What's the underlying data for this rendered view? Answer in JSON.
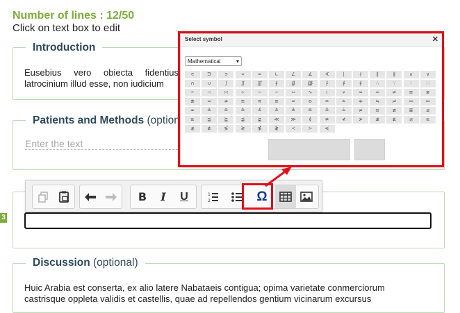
{
  "header": {
    "lines_count": "Number of lines : 12/50",
    "click_hint": "Click on text box to edit"
  },
  "sections": {
    "introduction": {
      "title": "Introduction",
      "text": "Eusebius vero obiecta fidentius latrocinium illud esse, non iudicium"
    },
    "patients_methods": {
      "title": "Patients and Methods",
      "optional": "(optional)",
      "placeholder": "Enter the text"
    },
    "results": {
      "badge": "3"
    },
    "discussion": {
      "title": "Discussion",
      "optional": "(optional)",
      "line1": "Huic Arabia est conserta, ex alio latere Nabataeis contigua; opima varietate conmerciorum",
      "line2": "castrisque oppleta validis et castellis, quae ad repellendos gentium vicinarum excursus"
    }
  },
  "toolbar": {
    "buttons": [
      "copy-icon",
      "paste-icon",
      "undo-icon",
      "redo-icon",
      "bold",
      "italic",
      "underline",
      "numbered-list-icon",
      "bulleted-list-icon",
      "omega-icon",
      "table-icon",
      "image-icon"
    ],
    "bold_label": "B",
    "italic_label": "I",
    "underline_label": "U",
    "omega_label": "Ω"
  },
  "dialog": {
    "title": "Select symbol",
    "close": "✕",
    "category": "Mathematical",
    "symbols": [
      [
        "∊",
        "∋",
        "∍",
        "∝",
        "∞",
        "∟",
        "∠",
        "∡",
        "∢",
        "∣",
        "∤",
        "∥",
        "∦",
        "∧",
        "∨"
      ],
      [
        "∩",
        "∪",
        "∫",
        "∬",
        "∭",
        "∮",
        "∯",
        "∰",
        "∱",
        "∲",
        "∳",
        "∴",
        "∵",
        "∶",
        "∷"
      ],
      [
        "∸",
        "∹",
        "∺",
        "∻",
        "∼",
        "∽",
        "∾",
        "∿",
        "≀",
        "≁",
        "≂",
        "≃",
        "≄",
        "≅",
        "≆"
      ],
      [
        "≇",
        "≈",
        "≉",
        "≊",
        "≋",
        "≌",
        "≍",
        "≎",
        "≏",
        "≐",
        "≑",
        "≒",
        "≓",
        "≔",
        "≕"
      ],
      [
        "≖",
        "≗",
        "≘",
        "≙",
        "≚",
        "≛",
        "≜",
        "≝",
        "≞",
        "≟",
        "≠",
        "≡",
        "≢",
        "≣",
        "≤"
      ],
      [
        "≥",
        "≦",
        "≧",
        "≨",
        "≩",
        "≪",
        "≫",
        "≬",
        "≭",
        "≮",
        "≯",
        "≰",
        "≱",
        "≲",
        "≳"
      ],
      [
        "≴",
        "≵",
        "≶",
        "≷",
        "≸",
        "≹",
        "≺",
        "≻",
        "≼"
      ]
    ],
    "colors": {
      "highlight": "#e0101a",
      "accent": "#7cae3a"
    }
  }
}
